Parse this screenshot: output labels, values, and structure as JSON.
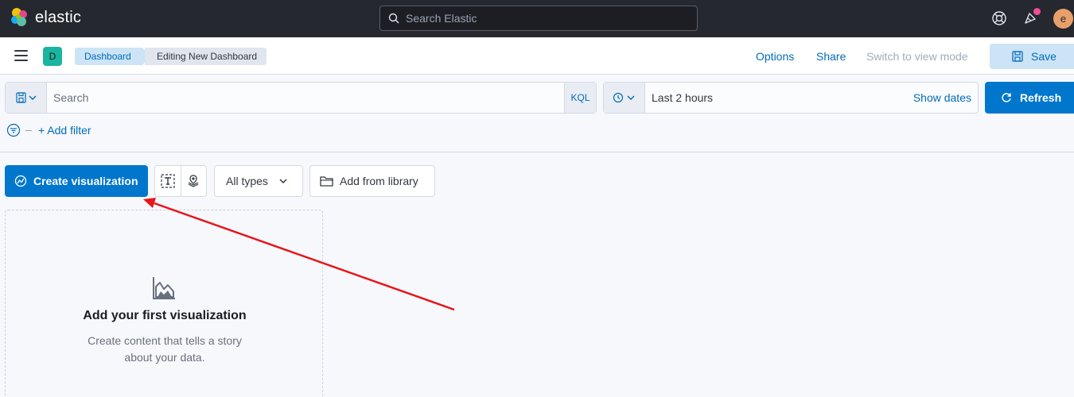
{
  "app": {
    "brand": "elastic"
  },
  "topbar": {
    "search_placeholder": "Search Elastic",
    "avatar_initial": "e"
  },
  "header": {
    "space_initial": "D",
    "breadcrumbs": [
      "Dashboard",
      "Editing New Dashboard"
    ],
    "options_label": "Options",
    "share_label": "Share",
    "switch_label": "Switch to view mode",
    "save_label": "Save"
  },
  "query": {
    "search_placeholder": "Search",
    "language": "KQL",
    "date_range": "Last 2 hours",
    "show_dates_label": "Show dates",
    "refresh_label": "Refresh",
    "add_filter_label": "+ Add filter"
  },
  "toolbar": {
    "create_label": "Create visualization",
    "types_label": "All types",
    "library_label": "Add from library"
  },
  "empty_state": {
    "title": "Add your first visualization",
    "description": "Create content that tells a story about your data."
  },
  "colors": {
    "primary": "#0077cc",
    "header_dark": "#25282f",
    "annotation_arrow": "#e8141a"
  }
}
